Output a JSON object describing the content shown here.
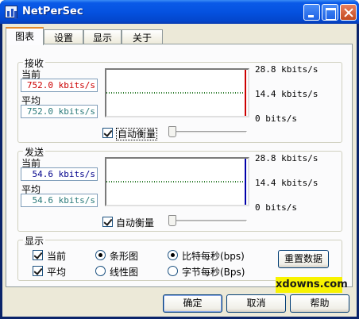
{
  "window": {
    "title": "NetPerSec"
  },
  "tabs": [
    {
      "label": "图表",
      "active": true
    },
    {
      "label": "设置",
      "active": false
    },
    {
      "label": "显示",
      "active": false
    },
    {
      "label": "关于",
      "active": false
    }
  ],
  "receive": {
    "title": "接收",
    "current_label": "当前",
    "current_value": "752.0 kbits/s",
    "average_label": "平均",
    "average_value": "752.0 kbits/s",
    "scale_top": "28.8 kbits/s",
    "scale_mid": "14.4 kbits/s",
    "scale_bottom": "0  bits/s",
    "autoscale_label": "自动衡量",
    "autoscale_checked": true,
    "bar_color": "#cc0000",
    "avg_line_color": "#2a7a2a"
  },
  "send": {
    "title": "发送",
    "current_label": "当前",
    "current_value": "54.6 kbits/s",
    "average_label": "平均",
    "average_value": "54.6 kbits/s",
    "scale_top": "28.8 kbits/s",
    "scale_mid": "14.4 kbits/s",
    "scale_bottom": "0  bits/s",
    "autoscale_label": "自动衡量",
    "autoscale_checked": true,
    "bar_color": "#0000aa",
    "avg_line_color": "#2a7a2a"
  },
  "display": {
    "title": "显示",
    "show_current_label": "当前",
    "show_current_checked": true,
    "show_average_label": "平均",
    "show_average_checked": true,
    "bar_chart_label": "条形图",
    "line_chart_label": "线性图",
    "chart_mode": "bar",
    "bits_label": "比特每秒(bps)",
    "bytes_label": "字节每秒(Bps)",
    "unit_mode": "bits",
    "reset_button": "重置数据"
  },
  "footer": {
    "ok": "确定",
    "cancel": "取消",
    "help": "帮助"
  },
  "watermark": "xdowns.com",
  "colors": {
    "current_recv_text": "#cc0000",
    "current_send_text": "#00008b",
    "average_text": "#2a7a7a"
  }
}
